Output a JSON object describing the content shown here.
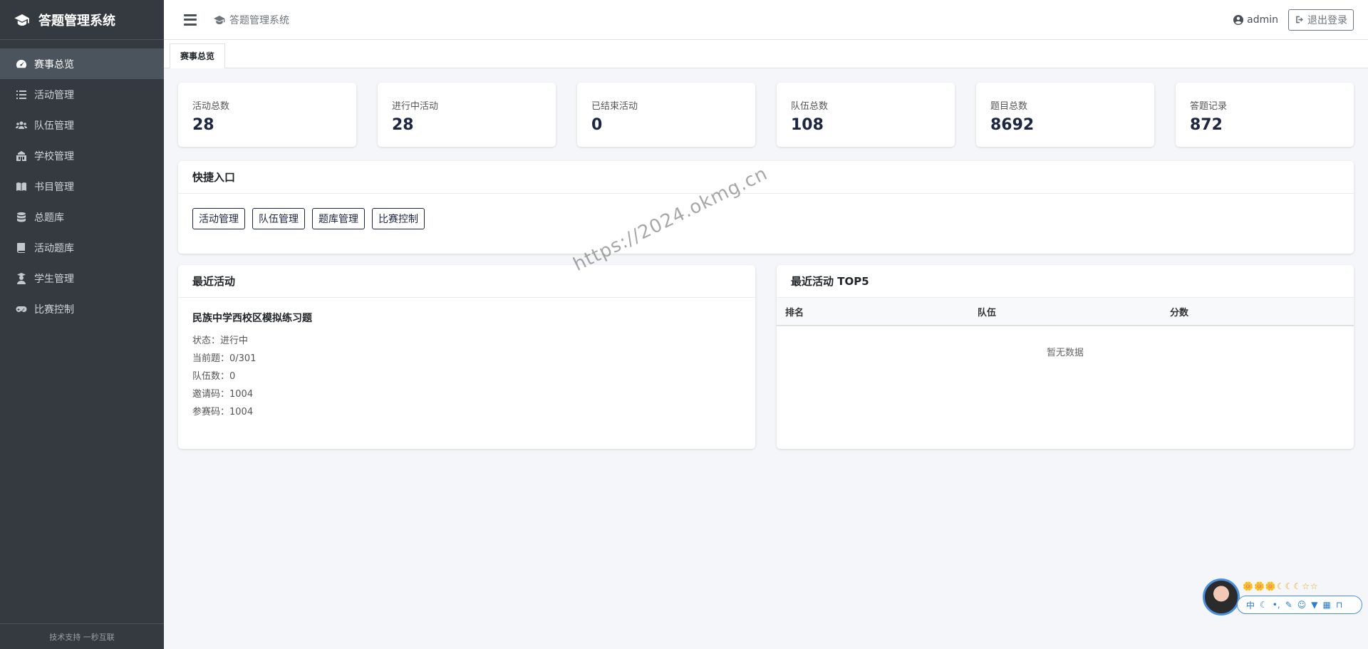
{
  "sidebar": {
    "brand": "答题管理系统",
    "items": [
      {
        "label": "赛事总览",
        "icon": "dashboard-icon",
        "active": true
      },
      {
        "label": "活动管理",
        "icon": "list-icon",
        "active": false
      },
      {
        "label": "队伍管理",
        "icon": "users-icon",
        "active": false
      },
      {
        "label": "学校管理",
        "icon": "school-icon",
        "active": false
      },
      {
        "label": "书目管理",
        "icon": "book-open-icon",
        "active": false
      },
      {
        "label": "总题库",
        "icon": "database-icon",
        "active": false
      },
      {
        "label": "活动题库",
        "icon": "book-icon",
        "active": false
      },
      {
        "label": "学生管理",
        "icon": "student-icon",
        "active": false
      },
      {
        "label": "比赛控制",
        "icon": "gamepad-icon",
        "active": false
      }
    ],
    "footer": "技术支持 一秒互联"
  },
  "header": {
    "title": "答题管理系统",
    "user": "admin",
    "logout": "退出登录"
  },
  "tabs": [
    {
      "label": "赛事总览"
    }
  ],
  "stats": [
    {
      "label": "活动总数",
      "value": "28"
    },
    {
      "label": "进行中活动",
      "value": "28"
    },
    {
      "label": "已结束活动",
      "value": "0"
    },
    {
      "label": "队伍总数",
      "value": "108"
    },
    {
      "label": "题目总数",
      "value": "8692"
    },
    {
      "label": "答题记录",
      "value": "872"
    }
  ],
  "quick": {
    "title": "快捷入口",
    "buttons": [
      "活动管理",
      "队伍管理",
      "题库管理",
      "比赛控制"
    ]
  },
  "recent": {
    "title": "最近活动",
    "name": "民族中学西校区模拟练习题",
    "lines": [
      "状态：进行中",
      "当前题：0/301",
      "队伍数：0",
      "邀请码：1004",
      "参赛码：1004"
    ]
  },
  "top5": {
    "title": "最近活动 TOP5",
    "columns": [
      "排名",
      "队伍",
      "分数"
    ],
    "empty": "暂无数据"
  },
  "watermark": "https://2024.okmg.cn",
  "widget": {
    "stars": "🌼🌼🌼☾☾☾☆☆",
    "bar_label": "中"
  }
}
